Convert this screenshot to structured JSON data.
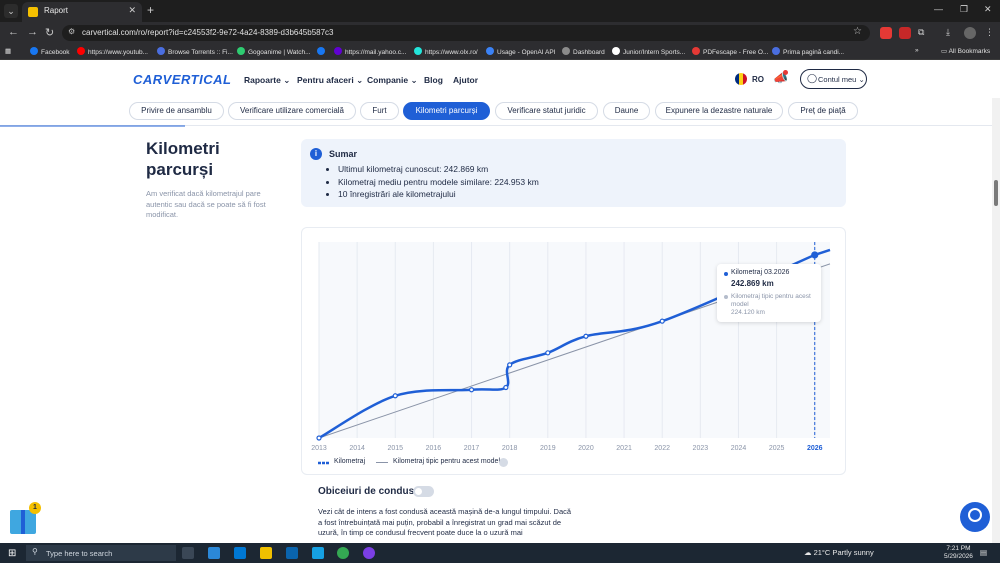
{
  "browser": {
    "tab_title": "Raport",
    "url": "carvertical.com/ro/report?id=c24553f2-9e72-4a24-8389-d3b645b587c3",
    "bookmarks": [
      {
        "label": "Facebook",
        "color": "#1877f2"
      },
      {
        "label": "https://www.youtub...",
        "color": "#ff0000"
      },
      {
        "label": "Browse Torrents :: Fi...",
        "color": "#4a6ee0"
      },
      {
        "label": "Gogoanime | Watch...",
        "color": "#2ecc71"
      },
      {
        "label": "",
        "color": "#1877f2"
      },
      {
        "label": "https://mail.yahoo.c...",
        "color": "#6001d2"
      },
      {
        "label": "https://www.olx.ro/",
        "color": "#23e5db"
      },
      {
        "label": "Usage - OpenAI API",
        "color": "#3b82f6"
      },
      {
        "label": "Dashboard",
        "color": "#8b8b8b"
      },
      {
        "label": "Junior/Intern Sports...",
        "color": "#ffffff"
      },
      {
        "label": "PDFescape - Free O...",
        "color": "#e53935"
      },
      {
        "label": "Prima pagină candi...",
        "color": "#4a6ee0"
      }
    ],
    "all_bookmarks": "All Bookmarks"
  },
  "header": {
    "logo": "CARVERTICAL",
    "menu": [
      "Rapoarte",
      "Pentru afaceri",
      "Companie",
      "Blog",
      "Ajutor"
    ],
    "lang": "RO",
    "account": "Contul meu"
  },
  "section_tabs": [
    {
      "label": "Privire de ansamblu",
      "active": false
    },
    {
      "label": "Verificare utilizare comercială",
      "active": false
    },
    {
      "label": "Furt",
      "active": false
    },
    {
      "label": "Kilometri parcurși",
      "active": true
    },
    {
      "label": "Verificare statut juridic",
      "active": false
    },
    {
      "label": "Daune",
      "active": false
    },
    {
      "label": "Expunere la dezastre naturale",
      "active": false
    },
    {
      "label": "Preț de piață",
      "active": false
    }
  ],
  "mileage": {
    "title": "Kilometri parcurși",
    "description": "Am verificat dacă kilometrajul pare autentic sau dacă se poate să fi fost modificat.",
    "summary_title": "Sumar",
    "summary_items": [
      "Ultimul kilometraj cunoscut: 242.869 km",
      "Kilometraj mediu pentru modele similare: 224.953 km",
      "10 înregistrări ale kilometrajului"
    ]
  },
  "tooltip": {
    "label": "Kilometraj 03.2026",
    "value": "242.869 km",
    "typical_label": "Kilometraj tipic pentru acest model",
    "typical_value": "224.120 km"
  },
  "legend": {
    "series_1": "Kilometraj",
    "series_2": "Kilometraj tipic pentru acest model"
  },
  "chart_data": {
    "type": "line",
    "x_ticks": [
      "2013",
      "2014",
      "2015",
      "2016",
      "2017",
      "2018",
      "2019",
      "2020",
      "2021",
      "2022",
      "2023",
      "2024",
      "2025",
      "2026"
    ],
    "xlim": [
      2013,
      2026.4
    ],
    "ylim": [
      0,
      260000
    ],
    "series": [
      {
        "name": "Kilometraj",
        "color": "#1f5fd6",
        "points": [
          [
            2013.0,
            0
          ],
          [
            2015.0,
            56000
          ],
          [
            2017.0,
            64000
          ],
          [
            2017.9,
            67000
          ],
          [
            2018.0,
            97000
          ],
          [
            2019.0,
            113000
          ],
          [
            2020.0,
            135000
          ],
          [
            2022.0,
            155000
          ],
          [
            2026.0,
            242869
          ]
        ]
      },
      {
        "name": "Kilometraj tipic pentru acest model",
        "color": "#8a94a8",
        "points": [
          [
            2013.0,
            0
          ],
          [
            2026.0,
            224120
          ],
          [
            2026.4,
            231000
          ]
        ]
      }
    ],
    "marker_x": 2026.0,
    "grid": true
  },
  "driving": {
    "title": "Obiceiuri de condus",
    "text": "Vezi cât de intens a fost condusă această mașină de-a lungul timpului. Dacă a fost întrebuințată mai puțin, probabil a înregistrat un grad mai scăzut de uzură, în timp ce condusul frecvent poate duce la o uzură mai"
  },
  "widgets": {
    "gift_count": "1"
  },
  "taskbar": {
    "search_placeholder": "Type here to search",
    "weather": "21°C  Partly sunny",
    "time": "7:21 PM",
    "date": "5/29/2026"
  }
}
